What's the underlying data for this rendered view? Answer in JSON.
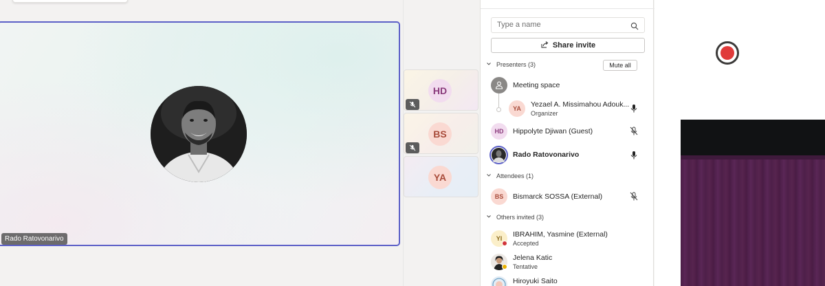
{
  "stage": {
    "main_participant_name": "Rado Ratovonarivo"
  },
  "thumbnails": [
    {
      "initials": "HD",
      "muted": true,
      "avatar_bg": "#f2dcef",
      "avatar_fg": "#8a3b7c"
    },
    {
      "initials": "BS",
      "muted": true,
      "avatar_bg": "#fad9d2",
      "avatar_fg": "#a84b3a"
    },
    {
      "initials": "YA",
      "muted": false,
      "avatar_bg": "#fad9d2",
      "avatar_fg": "#a84b3a"
    }
  ],
  "panel": {
    "search_placeholder": "Type a name",
    "share_invite_label": "Share invite",
    "presenters_label": "Presenters (3)",
    "mute_all_label": "Mute all",
    "attendees_label": "Attendees (1)",
    "others_label": "Others invited (3)",
    "meeting_space": {
      "name": "Meeting space"
    },
    "presenters": [
      {
        "initials": "YA",
        "name": "Yezael A. Missimahou Adouk...",
        "role": "Organizer",
        "mic": "on",
        "avatar_bg": "#fad9d2",
        "avatar_fg": "#a84b3a"
      },
      {
        "initials": "HD",
        "name": "Hippolyte Djiwan (Guest)",
        "mic": "off",
        "avatar_bg": "#f2dcef",
        "avatar_fg": "#8a3b7c"
      },
      {
        "initials": "",
        "name": "Rado Ratovonarivo",
        "mic": "on",
        "photo": true
      }
    ],
    "attendees": [
      {
        "initials": "BS",
        "name": "Bismarck SOSSA (External)",
        "mic": "off",
        "avatar_bg": "#fad9d2",
        "avatar_fg": "#a84b3a"
      }
    ],
    "others": [
      {
        "initials": "YI",
        "name": "IBRAHIM, Yasmine (External)",
        "status": "Accepted",
        "status_color": "#d13438",
        "avatar_bg": "#fbefc9",
        "avatar_fg": "#8a6a1c"
      },
      {
        "initials": "",
        "name": "Jelena Katic",
        "status": "Tentative",
        "status_color": "#e9b000",
        "photo": true
      },
      {
        "initials": "",
        "name": "Hiroyuki Saito",
        "status": "",
        "photo": true
      }
    ]
  },
  "colors": {
    "accent": "#5b5fc7",
    "record": "#e03a3a"
  }
}
